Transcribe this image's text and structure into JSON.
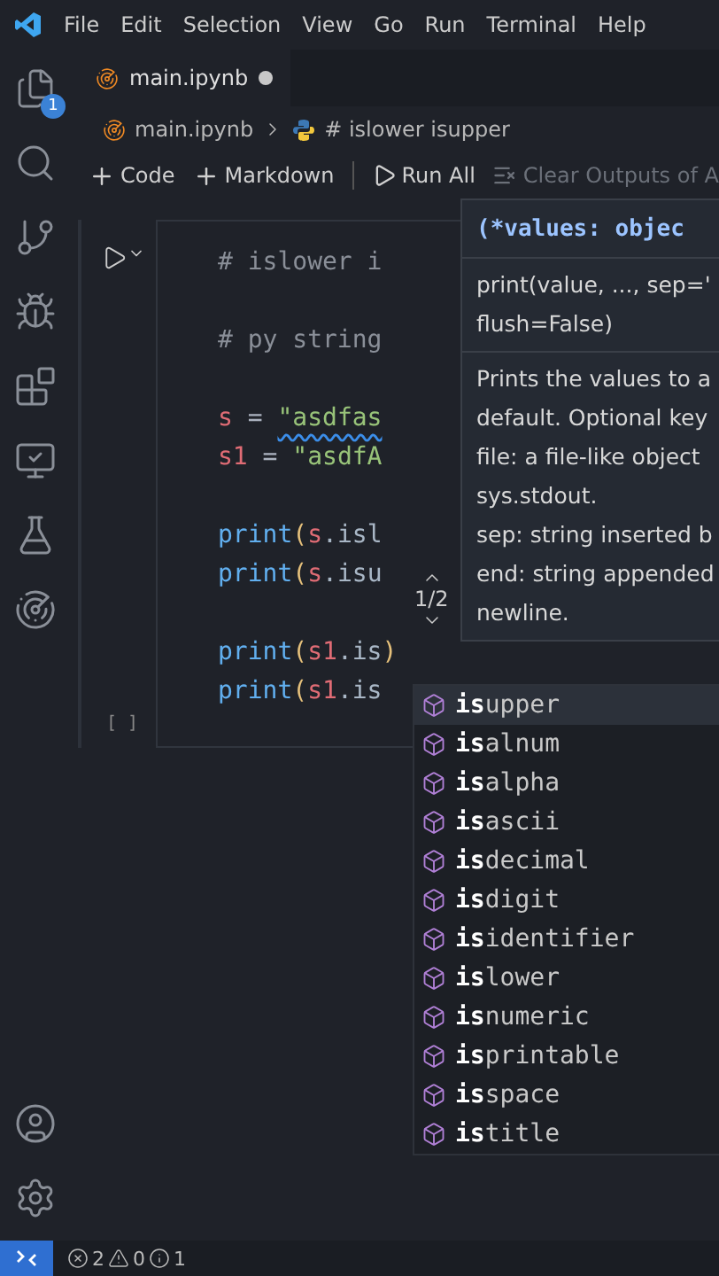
{
  "menu": [
    "File",
    "Edit",
    "Selection",
    "View",
    "Go",
    "Run",
    "Terminal",
    "Help"
  ],
  "activity_bar": {
    "explorer_badge": "1"
  },
  "editor_tab": {
    "label": "main.ipynb",
    "modified": true
  },
  "breadcrumbs": [
    "main.ipynb",
    "# islower isupper"
  ],
  "toolbar": [
    "Code",
    "Markdown",
    "Run All",
    "Clear Outputs of A"
  ],
  "cell": {
    "execution_count": "[ ]",
    "lines": [
      {
        "kind": "code",
        "tokens": [
          {
            "kind": "comment",
            "text": "# islower i"
          }
        ]
      },
      {
        "kind": "blank"
      },
      {
        "kind": "code",
        "tokens": [
          {
            "kind": "comment",
            "text": "# py string"
          }
        ]
      },
      {
        "kind": "blank"
      },
      {
        "kind": "code",
        "tokens": [
          {
            "kind": "var",
            "text": "s"
          },
          {
            "kind": "op",
            "text": " = "
          },
          {
            "kind": "string",
            "text": "\"asdfas",
            "squiggle": true
          }
        ]
      },
      {
        "kind": "code",
        "tokens": [
          {
            "kind": "var",
            "text": "s1"
          },
          {
            "kind": "op",
            "text": " = "
          },
          {
            "kind": "string",
            "text": "\"asdfA"
          }
        ]
      },
      {
        "kind": "blank"
      },
      {
        "kind": "code",
        "tokens": [
          {
            "kind": "func",
            "text": "print"
          },
          {
            "kind": "paren",
            "text": "("
          },
          {
            "kind": "var",
            "text": "s"
          },
          {
            "kind": "attr",
            "text": ".isl"
          }
        ]
      },
      {
        "kind": "code",
        "tokens": [
          {
            "kind": "func",
            "text": "print"
          },
          {
            "kind": "paren",
            "text": "("
          },
          {
            "kind": "var",
            "text": "s"
          },
          {
            "kind": "attr",
            "text": ".isu"
          }
        ]
      },
      {
        "kind": "blank"
      },
      {
        "kind": "code",
        "tokens": [
          {
            "kind": "func",
            "text": "print"
          },
          {
            "kind": "paren",
            "text": "("
          },
          {
            "kind": "var",
            "text": "s1"
          },
          {
            "kind": "attr",
            "text": ".is"
          },
          {
            "kind": "paren",
            "text": ")"
          }
        ]
      },
      {
        "kind": "code",
        "tokens": [
          {
            "kind": "func",
            "text": "print"
          },
          {
            "kind": "paren",
            "text": "("
          },
          {
            "kind": "var",
            "text": "s1"
          },
          {
            "kind": "attr",
            "text": ".is"
          }
        ]
      }
    ]
  },
  "parameter_hint": {
    "signature": "(*values: objec",
    "counter": "1/2",
    "lines": [
      "print(value, ..., sep='",
      "flush=False)"
    ],
    "doc": [
      "Prints the values to a",
      "default. Optional key",
      "file: a file-like object",
      "sys.stdout.",
      "sep: string inserted b",
      "end: string appended",
      "newline."
    ]
  },
  "suggestions": [
    {
      "label": "**is**upper",
      "selected": true
    },
    {
      "label": "**is**alnum",
      "selected": false
    },
    {
      "label": "**is**alpha",
      "selected": false
    },
    {
      "label": "**is**ascii",
      "selected": false
    },
    {
      "label": "**is**decimal",
      "selected": false
    },
    {
      "label": "**is**digit",
      "selected": false
    },
    {
      "label": "**is**identifier",
      "selected": false
    },
    {
      "label": "**is**lower",
      "selected": false
    },
    {
      "label": "**is**numeric",
      "selected": false
    },
    {
      "label": "**is**printable",
      "selected": false
    },
    {
      "label": "**is**space",
      "selected": false
    },
    {
      "label": "**is**title",
      "selected": false
    }
  ],
  "status_bar": {
    "errors": "2",
    "warnings": "0",
    "infos": "1"
  }
}
